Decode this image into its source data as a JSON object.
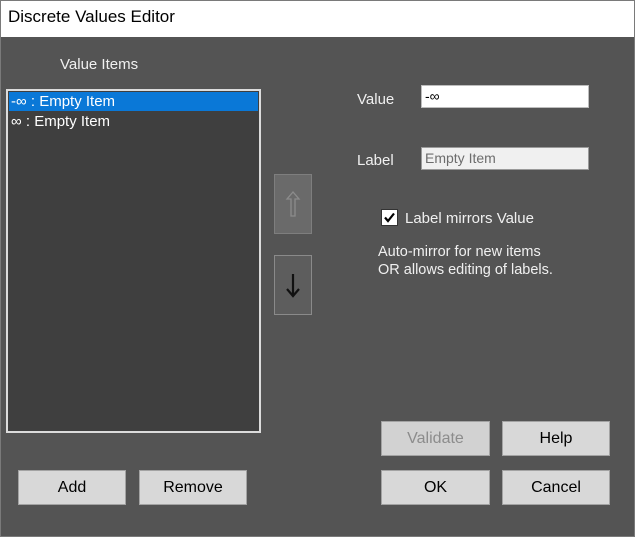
{
  "window": {
    "title": "Discrete Values Editor"
  },
  "list": {
    "header": "Value Items",
    "items": [
      {
        "text": "-∞ : Empty Item",
        "selected": true
      },
      {
        "text": "∞ : Empty Item",
        "selected": false
      }
    ]
  },
  "editor": {
    "value_label": "Value",
    "value": "-∞",
    "label_label": "Label",
    "label_value": "Empty Item",
    "mirror_checkbox_label": "Label mirrors Value",
    "mirror_checked": true,
    "help_line1": "Auto-mirror for new items",
    "help_line2": "OR allows editing of labels."
  },
  "buttons": {
    "add": "Add",
    "remove": "Remove",
    "validate": "Validate",
    "help": "Help",
    "ok": "OK",
    "cancel": "Cancel"
  },
  "icons": {
    "move_up": "arrow-up-icon",
    "move_down": "arrow-down-icon",
    "check": "checkmark-icon"
  },
  "colors": {
    "background": "#545454",
    "selection": "#0a78d7",
    "listbox": "#3f3f3f"
  }
}
